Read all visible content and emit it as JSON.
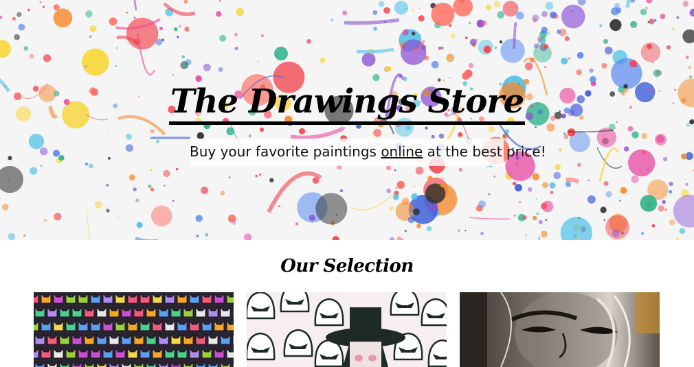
{
  "hero": {
    "title": "The Drawings Store",
    "subtitle_before": "Buy your favorite paintings ",
    "subtitle_emphasis": "online",
    "subtitle_after": " at the best price!"
  },
  "selection": {
    "title": "Our Selection",
    "paintings": [
      {
        "image": "colorful-cats-pattern-painting"
      },
      {
        "image": "stormtroopers-graffiti-painting"
      },
      {
        "image": "portrait-woman-graffiti-painting"
      }
    ]
  },
  "colors": {
    "background": "#ffffff",
    "text": "#000000",
    "splash_red": "#f2434b",
    "splash_blue": "#3a5ad9",
    "splash_yellow": "#f7d63a",
    "splash_orange": "#f58a2c"
  }
}
